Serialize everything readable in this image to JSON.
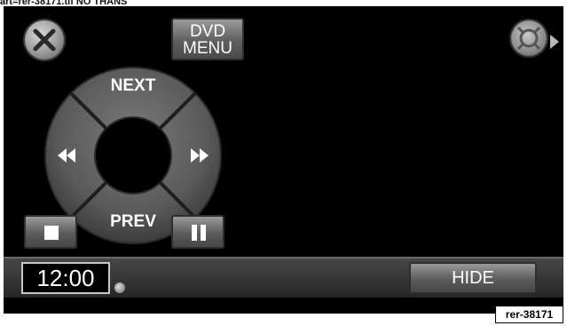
{
  "caption": "art=rer-38171.tif        NO THANS",
  "top_bar": {
    "close_icon": "close-x-icon",
    "dvd_menu_line1": "DVD",
    "dvd_menu_line2": "MENU",
    "right_control_icon": "directional-pad-icon"
  },
  "dial": {
    "next": "NEXT",
    "prev": "PREV",
    "rewind_icon": "rewind-icon",
    "fast_forward_icon": "fast-forward-icon"
  },
  "playback": {
    "stop_icon": "stop-icon",
    "pause_icon": "pause-icon"
  },
  "bottom_bar": {
    "time": "12:00",
    "hide": "HIDE"
  },
  "reference_tag": "rer-38171"
}
